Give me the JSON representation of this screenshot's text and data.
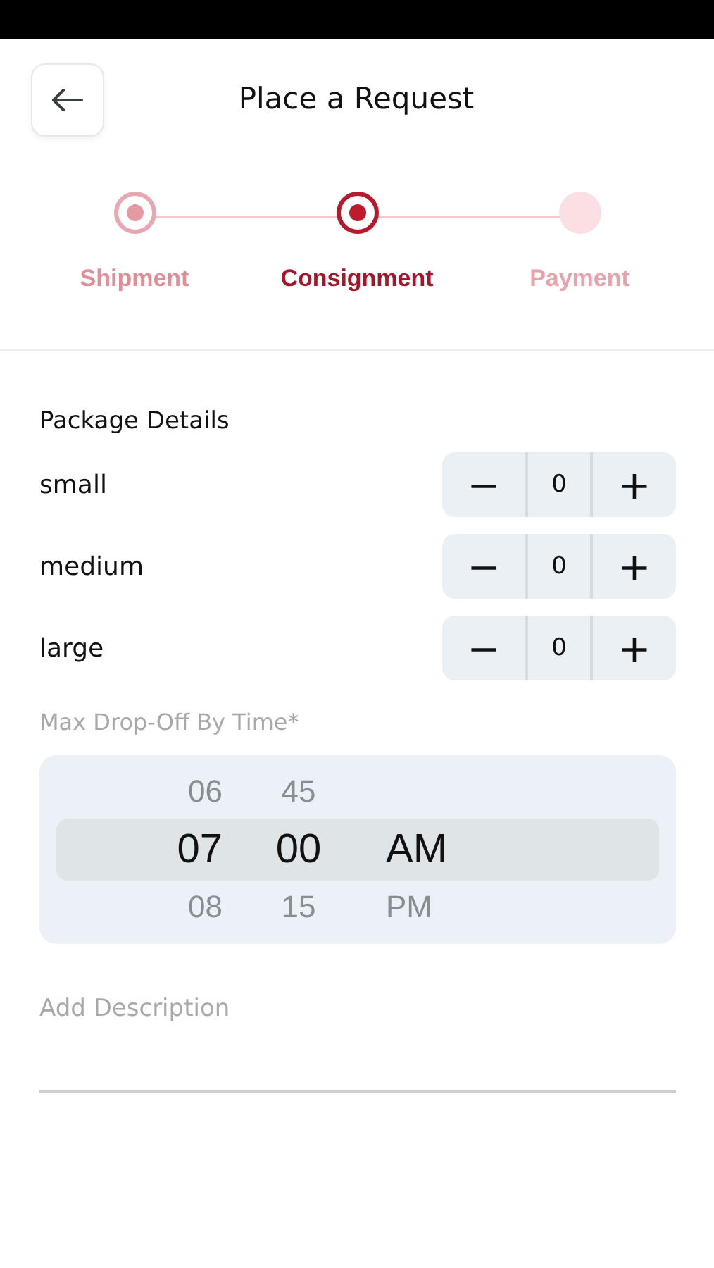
{
  "header": {
    "title": "Place a Request"
  },
  "steps": [
    {
      "label": "Shipment",
      "completed": true,
      "selected": false
    },
    {
      "label": "Consignment",
      "completed": false,
      "selected": true
    },
    {
      "label": "Payment",
      "completed": false,
      "selected": false
    }
  ],
  "package_details": {
    "title": "Package Details",
    "items": [
      {
        "name": "small",
        "minus": "−",
        "count": "0",
        "plus": "+"
      },
      {
        "name": "medium",
        "minus": "−",
        "count": "0",
        "plus": "+"
      },
      {
        "name": "large",
        "minus": "−",
        "count": "0",
        "plus": "+"
      }
    ]
  },
  "drop_off_time": {
    "label": "Max Drop-Off By Time*",
    "rows": [
      {
        "hour": "06",
        "minute": "45",
        "period": "",
        "selected": false
      },
      {
        "hour": "07",
        "minute": "00",
        "period": "AM",
        "selected": true
      },
      {
        "hour": "08",
        "minute": "15",
        "period": "PM",
        "selected": false
      }
    ]
  },
  "description": {
    "placeholder": "Add Description"
  }
}
